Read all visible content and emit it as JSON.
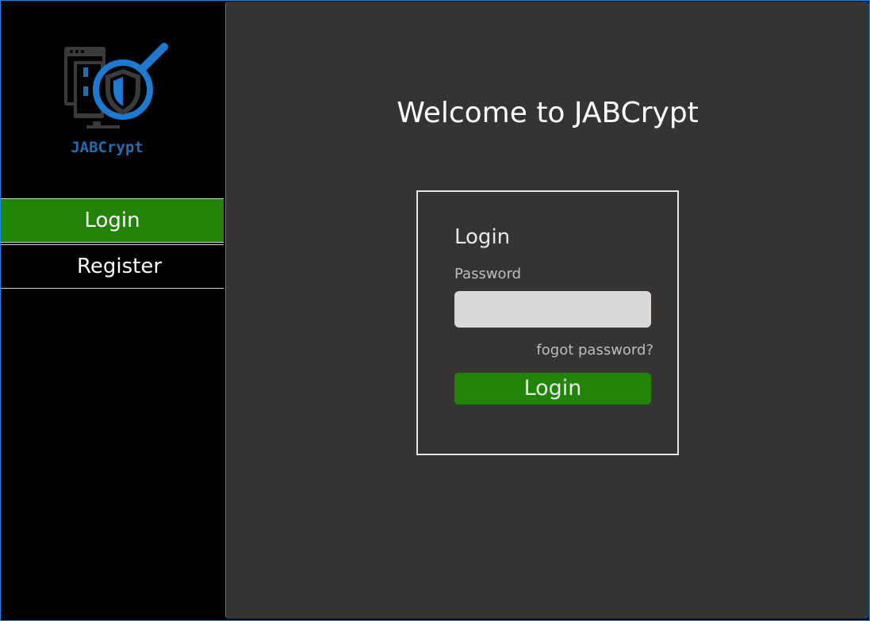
{
  "app": {
    "name": "JABCrypt",
    "logo_icon": "shield-magnifier-monitor-logo",
    "colors": {
      "accent_green": "#228406",
      "brand_blue": "#1d6fb8",
      "main_bg": "#353432",
      "sidebar_bg": "#000000"
    }
  },
  "sidebar": {
    "items": [
      {
        "label": "Login",
        "active": true
      },
      {
        "label": "Register",
        "active": false
      }
    ]
  },
  "main": {
    "welcome_title": "Welcome to JABCrypt",
    "login_form": {
      "title": "Login",
      "password_label": "Password",
      "password_value": "",
      "forgot_link": "fogot password?",
      "submit_label": "Login"
    }
  }
}
